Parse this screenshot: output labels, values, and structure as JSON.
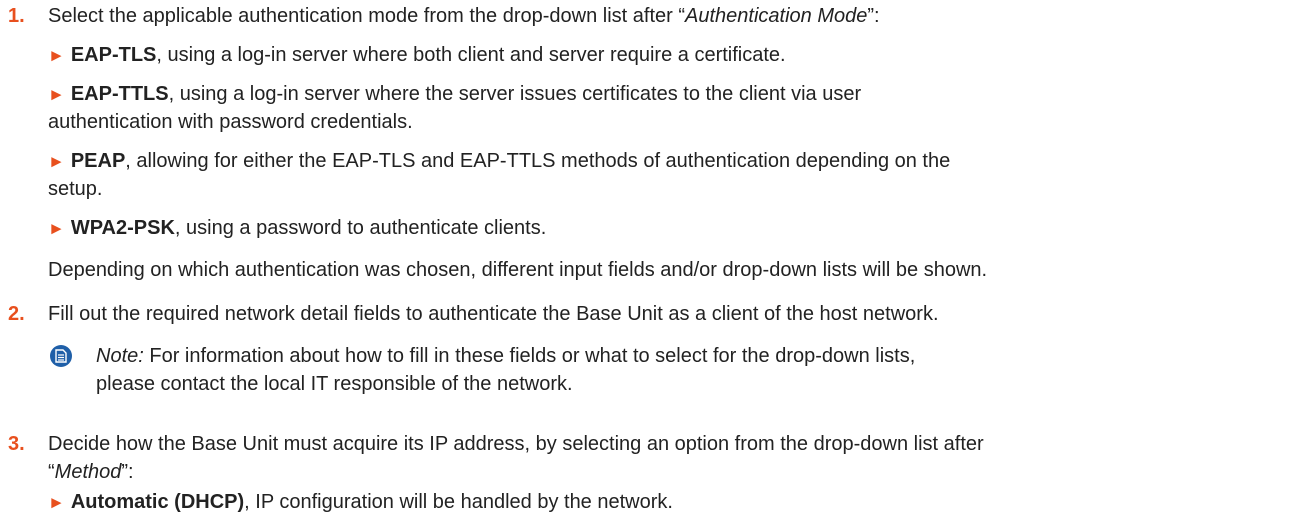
{
  "step1": {
    "number": "1.",
    "text_pre": "Select the applicable authentication mode from the drop-down list after “",
    "text_em": "Authentication Mode",
    "text_post": "”:",
    "bullets": [
      {
        "marker": "►",
        "term": "EAP-TLS",
        "rest": ", using a log-in server where both client and server require a certificate."
      },
      {
        "marker": "►",
        "term": "EAP-TTLS",
        "rest": ", using a log-in server where the server issues certificates to the client via user",
        "rest2": "authentication with password credentials."
      },
      {
        "marker": "►",
        "term": "PEAP",
        "rest": ", allowing for either the EAP-TLS and EAP-TTLS methods of authentication depending on the",
        "rest2": "setup."
      },
      {
        "marker": "►",
        "term": "WPA2-PSK",
        "rest": ", using a password to authenticate clients."
      }
    ],
    "after": "Depending on which authentication was chosen, different input fields and/or drop-down lists will be shown."
  },
  "step2": {
    "number": "2.",
    "text": "Fill out the required network detail fields to authenticate the Base Unit as a client of the host network.",
    "note_label": "Note:",
    "note_line1": " For information about how to fill in these fields or what to select for the drop-down lists,",
    "note_line2": "please contact the local IT responsible of the network.",
    "note_icon": "note-icon"
  },
  "step3": {
    "number": "3.",
    "text_line1": "Decide how the Base Unit must acquire its IP address, by selecting an option from the drop-down list after",
    "text_pre": "“",
    "text_em": "Method",
    "text_post": "”:",
    "bullet": {
      "marker": "►",
      "term": "Automatic (DHCP)",
      "rest": ", IP configuration will be handled by the network."
    }
  },
  "colors": {
    "accent": "#e8501e",
    "note_icon": "#1f5fa8",
    "text": "#222222"
  }
}
